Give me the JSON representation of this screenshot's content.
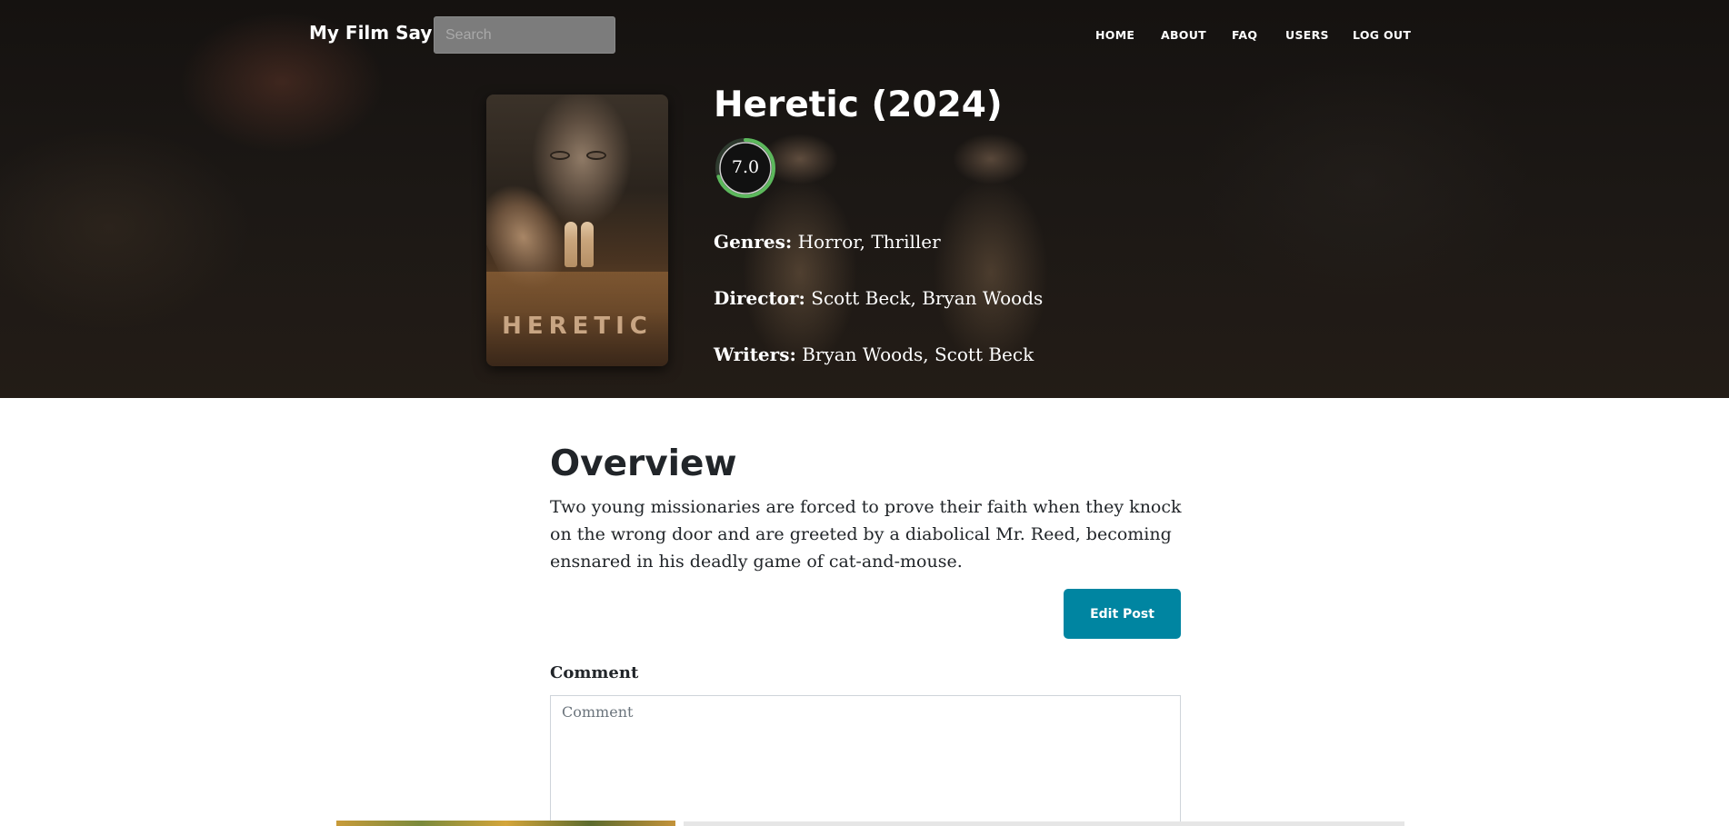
{
  "navbar": {
    "brand": "My Film Say",
    "search_placeholder": "Search",
    "links": [
      "HOME",
      "ABOUT",
      "FAQ",
      "USERS",
      "LOG OUT"
    ]
  },
  "poster": {
    "title_text": "HERETIC"
  },
  "movie": {
    "title": "Heretic (2024)",
    "rating": "7.0",
    "rating_fraction": 0.7,
    "genres_label": "Genres:",
    "genres": "Horror, Thriller",
    "director_label": "Director:",
    "director": "Scott Beck, Bryan Woods",
    "writers_label": "Writers:",
    "writers": "Bryan Woods, Scott Beck"
  },
  "overview": {
    "heading": "Overview",
    "text": "Two young missionaries are forced to prove their faith when they knock on the wrong door and are greeted by a diabolical Mr. Reed, becoming ensnared in his deadly game of cat-and-mouse.",
    "edit_button": "Edit Post"
  },
  "comment": {
    "label": "Comment",
    "placeholder": "Comment"
  },
  "colors": {
    "rating_ring": "#5cb85c",
    "button": "#0085a1"
  }
}
